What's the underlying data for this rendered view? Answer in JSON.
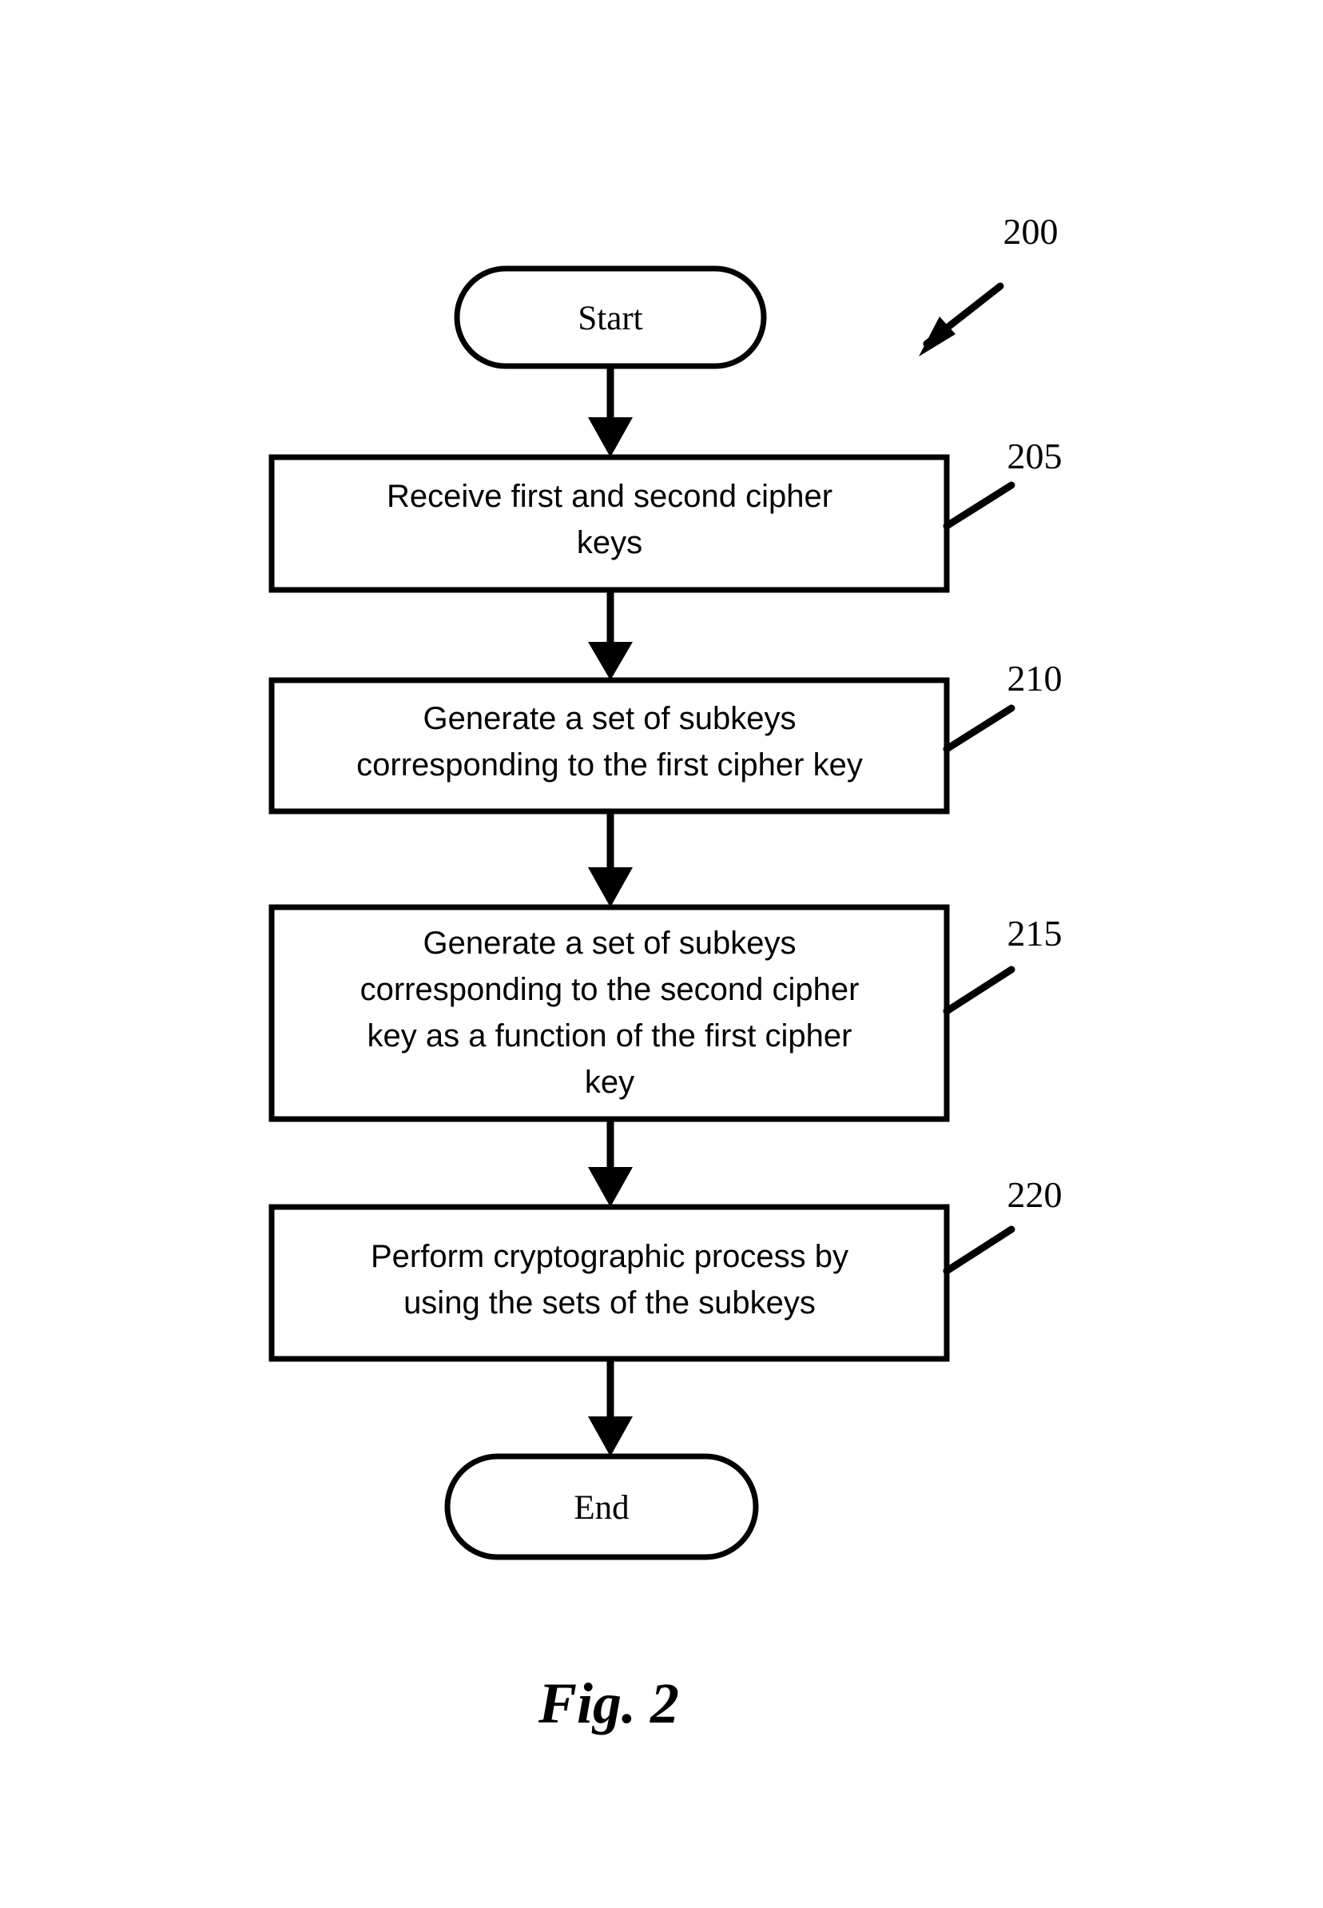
{
  "figure": {
    "caption": "Fig. 2",
    "overall_reference": "200",
    "title_visible": false
  },
  "nodes": [
    {
      "id": "start",
      "type": "terminator",
      "label": "Start",
      "lines": [
        "Start"
      ],
      "reference": null
    },
    {
      "id": "step-205",
      "type": "process",
      "label": "Receive first and second cipher keys",
      "lines": [
        "Receive first and second cipher",
        "keys"
      ],
      "reference": "205"
    },
    {
      "id": "step-210",
      "type": "process",
      "label": "Generate a set of subkeys corresponding to the first cipher key",
      "lines": [
        "Generate a set of subkeys",
        "corresponding to the first cipher key"
      ],
      "reference": "210"
    },
    {
      "id": "step-215",
      "type": "process",
      "label": "Generate a set of subkeys corresponding to the second cipher key as a function of the first cipher key",
      "lines": [
        "Generate a set of subkeys",
        "corresponding to the second cipher",
        "key as a function of the first cipher",
        "key"
      ],
      "reference": "215"
    },
    {
      "id": "step-220",
      "type": "process",
      "label": "Perform cryptographic process by using the sets of the subkeys",
      "lines": [
        "Perform cryptographic process by",
        "using the sets of the subkeys"
      ],
      "reference": "220"
    },
    {
      "id": "end",
      "type": "terminator",
      "label": "End",
      "lines": [
        "End"
      ],
      "reference": null
    }
  ],
  "edges": [
    {
      "from": "start",
      "to": "step-205",
      "style": "arrow"
    },
    {
      "from": "step-205",
      "to": "step-210",
      "style": "arrow"
    },
    {
      "from": "step-210",
      "to": "step-215",
      "style": "arrow"
    },
    {
      "from": "step-215",
      "to": "step-220",
      "style": "arrow"
    },
    {
      "from": "step-220",
      "to": "end",
      "style": "arrow"
    }
  ],
  "colors": {
    "background": "#ffffff",
    "stroke": "#000000",
    "text": "#000000"
  }
}
